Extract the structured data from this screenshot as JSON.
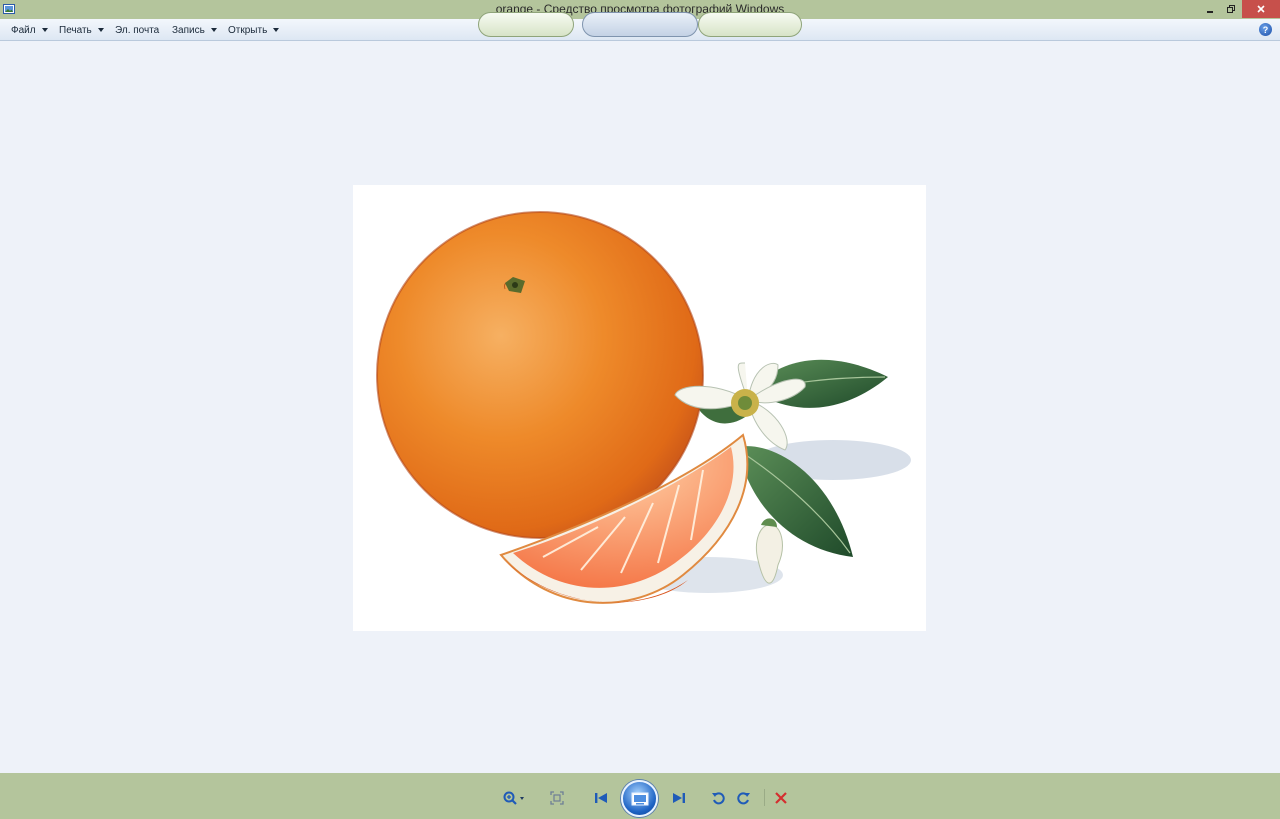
{
  "window": {
    "title": "orange - Средство просмотра фотографий Windows"
  },
  "menu": {
    "items": [
      {
        "label": "Файл",
        "has_arrow": true
      },
      {
        "label": "Печать",
        "has_arrow": true
      },
      {
        "label": "Эл. почта",
        "has_arrow": false
      },
      {
        "label": "Запись",
        "has_arrow": true
      },
      {
        "label": "Открыть",
        "has_arrow": true
      }
    ],
    "help_glyph": "?"
  },
  "icons": {
    "app": "photo-viewer-icon",
    "minimize": "minimize-icon",
    "restore": "restore-icon",
    "close": "close-icon",
    "help": "help-icon",
    "zoom": "zoom-icon",
    "actual_size": "actual-size-icon",
    "previous": "previous-icon",
    "slideshow": "slideshow-icon",
    "next": "next-icon",
    "rotate_ccw": "rotate-counterclockwise-icon",
    "rotate_cw": "rotate-clockwise-icon",
    "delete": "delete-icon"
  },
  "colors": {
    "titlebar": "#b4c59c",
    "canvas": "#eef2f9",
    "close_button": "#c7504b",
    "delete_icon": "#d42f2f",
    "accent_blue": "#1e63c4"
  },
  "image": {
    "content": "illustration of an orange with a slice, blossom and leaves"
  }
}
